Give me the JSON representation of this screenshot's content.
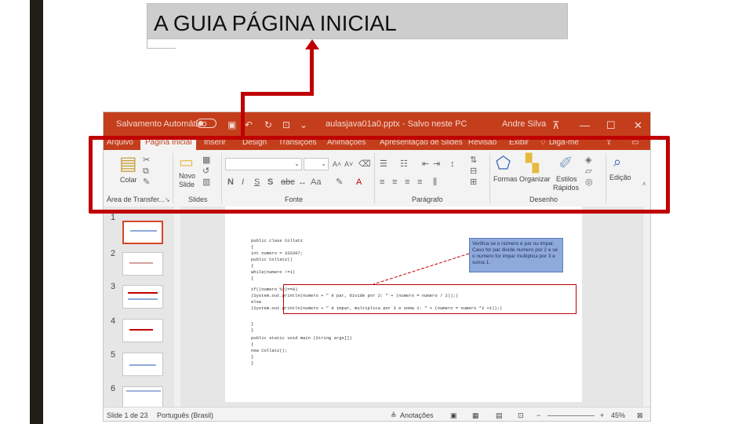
{
  "slide_title": "A GUIA PÁGINA INICIAL",
  "app": {
    "titlebar": {
      "autosave": "Salvamento Automático",
      "doc_title": "aulasjava01a0.pptx  -  Salvo neste PC",
      "user": "Andre Silva",
      "minimize": "—",
      "restore": "☐",
      "close": "✕"
    },
    "tabs": [
      "Arquivo",
      "Página Inicial",
      "Inserir",
      "Design",
      "Transições",
      "Animações",
      "Apresentação de Slides",
      "Revisão",
      "Exibir",
      "Diga-me"
    ],
    "ribbon": {
      "paste": "Colar",
      "new_slide_1": "Novo",
      "new_slide_2": "Slide",
      "shapes": "Formas",
      "arrange": "Organizar",
      "styles_1": "Estilos",
      "styles_2": "Rápidos",
      "editing": "Edição",
      "bold": "N",
      "italic": "I",
      "underline": "S",
      "strike": "S",
      "font_grow": "A˄",
      "font_shrink": "A˅",
      "case": "Aa",
      "groups": {
        "clipboard": "Área de Transfer...",
        "slides": "Slides",
        "font": "Fonte",
        "paragraph": "Parágrafo",
        "drawing": "Desenho"
      }
    },
    "thumbnails": [
      "1",
      "2",
      "3",
      "4",
      "5",
      "6"
    ],
    "code_lines": [
      "public class Collatz",
      "{",
      "  int numero = 333397;",
      "  public Collatz()",
      "  {",
      "    while(numero !=1)",
      "    {",
      "      if((numero %2)==0)",
      "        (System.out.println(numero + \" é par, divide por 2: \" + (numero = numero / 2));)",
      "      else",
      "        (System.out.println(numero + \" é impar, multiplica por 3 e soma 1: \" + (numero = numero *3 +1));)",
      "    }",
      "  }",
      "  public static void main (String args[])",
      "  {",
      "    new Collatz();",
      "  }",
      "}"
    ],
    "callout": "Verifica se o número é par ou impar. Caso for par divide numero por 2 e se o numero for impar multiplica por 3 e soma 1.",
    "status": {
      "slide": "Slide 1 de 23",
      "language": "Português (Brasil)",
      "notes": "Anotações",
      "zoom": "45%"
    }
  }
}
